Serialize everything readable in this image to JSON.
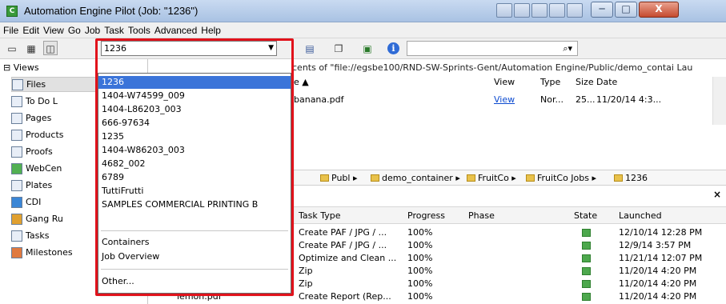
{
  "window": {
    "title": "Automation Engine Pilot (Job: \"1236\")",
    "app_icon": "C",
    "controls": {
      "minimize": "─",
      "maximize": "□",
      "close": "X"
    }
  },
  "menu": [
    "File",
    "Edit",
    "View",
    "Go",
    "Job",
    "Task",
    "Tools",
    "Advanced",
    "Help"
  ],
  "toolbar": {
    "job_combo_value": "1236",
    "search_value": "",
    "search_icon": "search-icon",
    "icons": [
      "monitor-icon",
      "grid-icon",
      "panel-icon",
      "folder-add-icon",
      "new-job-icon",
      "add-item-icon",
      "info-icon"
    ]
  },
  "dropdown": {
    "items": [
      "1236",
      "1404-W74599_009",
      "1404-L86203_003",
      "666-97634",
      "1235",
      "1404-W86203_003",
      "4682_002",
      "6789",
      "TuttiFrutti",
      "SAMPLES COMMERCIAL PRINTING B"
    ],
    "extra": [
      "Containers",
      "Job Overview"
    ],
    "other": "Other...",
    "selected_index": 0
  },
  "sidebar": {
    "header": "⊟ Views",
    "items": [
      {
        "label": "Files",
        "icon": "file-icon"
      },
      {
        "label": "To Do L",
        "icon": "todo-icon"
      },
      {
        "label": "Pages",
        "icon": "pages-icon"
      },
      {
        "label": "Products",
        "icon": "products-icon"
      },
      {
        "label": "Proofs",
        "icon": "proofs-icon"
      },
      {
        "label": "WebCen",
        "icon": "webcenter-icon"
      },
      {
        "label": "Plates",
        "icon": "plates-icon"
      },
      {
        "label": "CDI",
        "icon": "cdi-icon"
      },
      {
        "label": "Gang Ru",
        "icon": "gang-icon"
      },
      {
        "label": "Tasks",
        "icon": "tasks-icon"
      },
      {
        "label": "Milestones",
        "icon": "milestones-icon"
      }
    ]
  },
  "files": {
    "path": "cents of \"file://egsbe100/RND-SW-Sprints-Gent/Automation Engine/Public/demo_contai Lau",
    "headers": {
      "name": "e ▲",
      "view": "View",
      "type": "Type",
      "size": "Size",
      "date": "Date"
    },
    "rows": [
      {
        "name": "banana.pdf",
        "view": "View",
        "type": "Nor...",
        "size": "25...",
        "date": "11/20/14 4:3..."
      }
    ]
  },
  "breadcrumb": [
    "Publ ▸",
    "demo_container ▸",
    "FruitCo ▸",
    "FruitCo Jobs ▸",
    "1236"
  ],
  "tasks": {
    "headers": {
      "type": "Task Type",
      "progress": "Progress",
      "phase": "Phase",
      "state": "State",
      "launched": "Launched"
    },
    "rows": [
      {
        "type": "Create PAF / JPG / ...",
        "progress": "100%",
        "launched": "12/10/14 12:28 PM"
      },
      {
        "type": "Create PAF / JPG / ...",
        "progress": "100%",
        "launched": "12/9/14 3:57 PM"
      },
      {
        "type": "Optimize and Clean ...",
        "progress": "100%",
        "launched": "11/21/14 12:07 PM"
      },
      {
        "type": "Zip",
        "progress": "100%",
        "launched": "11/20/14 4:20 PM"
      },
      {
        "type": "Zip",
        "progress": "100%",
        "launched": "11/20/14 4:20 PM"
      },
      {
        "type": "Create Report (Rep...",
        "progress": "100%",
        "launched": "11/20/14 4:20 PM"
      }
    ],
    "partial_row_name": "lemon.pdf"
  },
  "colors": {
    "highlight": "#e1121b",
    "selection": "#3b74d9",
    "link": "#0d4bd0"
  }
}
